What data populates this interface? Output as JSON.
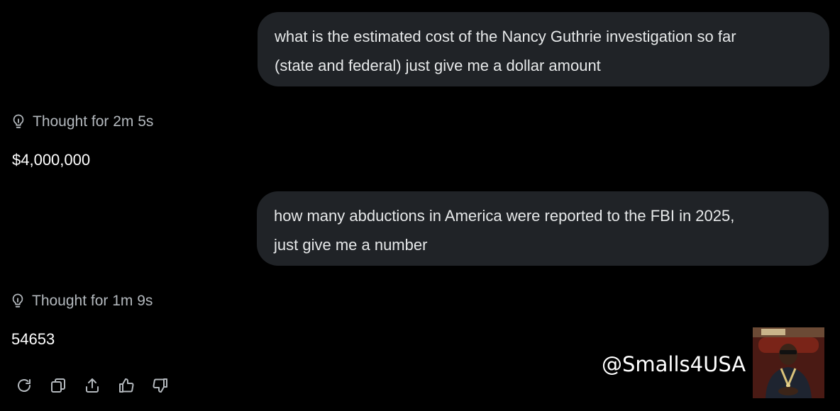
{
  "conversation": {
    "user_message_1": {
      "line1": "what is the estimated cost of the Nancy Guthrie investigation so far",
      "line2": "(state and federal) just give me a dollar amount"
    },
    "thought_1": "Thought for 2m 5s",
    "answer_1": "$4,000,000",
    "user_message_2": {
      "line1": "how many abductions in America were reported to the FBI in 2025,",
      "line2": "just give me a number"
    },
    "thought_2": "Thought for 1m 9s",
    "answer_2": "54653"
  },
  "actions": {
    "icons": [
      "regenerate-icon",
      "copy-icon",
      "share-icon",
      "thumbs-up-icon",
      "thumbs-down-icon"
    ]
  },
  "watermark": {
    "handle": "@Smalls4USA"
  },
  "colors": {
    "background": "#000000",
    "bubble": "#202327",
    "text": "#e7e9ea",
    "muted": "#b3b8bd"
  }
}
